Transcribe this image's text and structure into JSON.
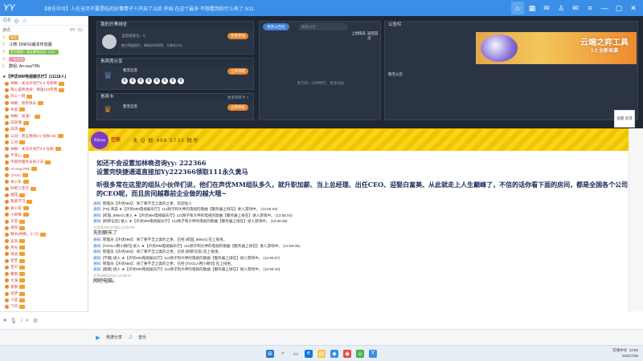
{
  "titlebar": {
    "logo": "YY",
    "title": "【收在中台】人在无尽不要是吃的好事情子人开启了以后 开始 在这个最多 不想看到的什么有了 0/11",
    "icons": [
      "home-icon",
      "grid-icon",
      "chat-icon",
      "shirt-icon",
      "mail-icon",
      "menu-icon",
      "minimize-icon",
      "maximize-icon",
      "close-icon"
    ]
  },
  "leftpanel": {
    "tools": [
      "G6",
      "◎",
      "☆"
    ],
    "header_left": "通讯",
    "header_right": "YY（1）",
    "ranks": [
      {
        "num": "1",
        "name": "老总",
        "extra": "精彩瞬间"
      },
      {
        "num": "2",
        "name": "斗琦: DNF60版本怀旧服",
        "extra": ""
      },
      {
        "num": "3",
        "name": "官方福利：周五晚场活动（6/8）",
        "extra": ""
      },
      {
        "num": "4",
        "name": "一起交流",
        "extra": ""
      },
      {
        "num": "5",
        "name": "群组: An-ssy/YRk",
        "extra": ""
      }
    ],
    "channel": "★【声优MM电视娱乐厅】(11118人)",
    "users": [
      "林枫：关注声优厅3 0 号频率",
      "现心提师连续：保送109年我",
      "开心一刻",
      "林枫：新年快乐",
      "木星",
      "林枫：加油！",
      "白玫瑰",
      "白鸽",
      "公司：周五晚场3 0 号频 6/8",
      "三月",
      "林枫：关注声优厅3 0 号频",
      "不开心",
      "不搞笑服务员的小天",
      "An-ssy/YRk",
      "小Ann",
      "张小乐",
      "好吧小宝贝",
      "烟花",
      "我爱学习",
      "翠小花",
      "小草莓",
      "天空",
      "清风",
      "静水(林枫，小小)",
      "追风",
      "月光",
      "海浪",
      "星空",
      "宝贝",
      "雾雨",
      "大海",
      "夜雨",
      "追梦",
      "小蓝",
      "飞鸟",
      "彩云",
      "风铃",
      "布丁",
      "林枫：关注声优厅3 0 号频",
      "心动",
      "Bo Bo Lo",
      "小明"
    ]
  },
  "main": {
    "card1": {
      "title": "我的开黑排坐",
      "status_label": "当前排坐位：0",
      "rule": "能力等级提升，每场实时获得，卡券总计分",
      "btn": "免费参加"
    },
    "card2": {
      "title": "贵宾席分享",
      "name": "暂无信息",
      "btn": "立即领取",
      "digits": [
        "0",
        "0",
        "0",
        "0",
        "0",
        "0",
        "0",
        "0"
      ]
    },
    "card3": {
      "title": "贵宾卡",
      "right": "更多贵宾卡 >",
      "name": "暂无信息",
      "btn": "立即领取"
    },
    "tabs": {
      "active": "贵宾公告栏",
      "search_placeholder": "搜索公告",
      "links": [
        "上周排名",
        "返回首页"
      ],
      "empty": "暂无每一分钟预告，更多动态"
    },
    "notice": {
      "title": "公告栏",
      "footer": "暂无公告"
    },
    "ad": {
      "line1": "云端之弈工具",
      "line2": "2.0 全新来袭"
    }
  },
  "announce": {
    "avatar_label": "声优MM",
    "name": "巴依",
    "qq": "永 Q 群 488 5733 群号"
  },
  "chat": {
    "big_lines": [
      "如还不会设置加林晚咨询yy: 222366",
      "设置完快捷通道直接加Yy222366领取111永久黄马",
      "",
      "听很多常在这里的组队小伙伴们说，他们在声优MM组队多久，就升职加薪、当上总经理、出任CEO、迎娶白富美、从此就走上人生巅峰了，不信的话你看下面的房间，都是全国各个公司的CEO呢，而且房间越靠前企业做的越大哦~"
    ],
    "messages": [
      {
        "tag": "通知:",
        "text": "管理员【声优MM】：除了要不乏之类的之余，欢迎加入"
      },
      {
        "tag": "通知:",
        "text": "[TN] 来自 ★【声优MM电视娱乐厅】111频子和大神的电视的歌曲【服务器上排在】进入游戏中。  (12:55:04)"
      },
      {
        "tag": "通知:",
        "text": "[校园_885e2] 进入 ★【声优MM电视娱乐厅】111频子和大神的电视的歌曲【服务器上排在】进入游戏中。  (12:55:04)"
      },
      {
        "tag": "通知:",
        "text": "[刷新信息] 进入 ★【声优MM电视娱乐厅】111频子和大神的电视的歌曲【服务器上排在】进入游戏中。  (12:55:05)"
      },
      {
        "tag": "",
        "text": "小宜灵(76137000)  12:55:05",
        "user": true
      },
      {
        "tag": "",
        "text": "先别聊天了",
        "plain": true
      },
      {
        "tag": "通知:",
        "text": "管理员【声优MM】：除了要不乏之类的之余，已经 [校园_885e2] 在上排坐。"
      },
      {
        "tag": "通知:",
        "text": "[TOGLA用小顾问] 进入 ★【声优MM电视娱乐厅】111频子和大神的电视的歌曲【服务器上排在】进入游戏中。  (12:55:06)"
      },
      {
        "tag": "通知:",
        "text": "管理员【声优MM】：除了要不乏之类的之余，已经 [刷新信息] 在上排坐。"
      },
      {
        "tag": "通知:",
        "text": "[不期] 进入 ★【声优MM电视娱乐厅】111频子和大神的电视的歌曲【服务器上排在】进入游戏中。  (12:55:07)"
      },
      {
        "tag": "通知:",
        "text": "管理员【声优MM】：除了要不乏之类的之余，已经 [TOGLA用小顾问] 在上排坐。"
      },
      {
        "tag": "通知:",
        "text": "[跟歌] 进入 ★【声优MM电视娱乐厅】111频子和大神的电视的歌曲【服务器上排在】进入游戏中。  (12:55:10)"
      },
      {
        "tag": "",
        "text": "天色(96821011)  12:55:10",
        "user": true
      },
      {
        "tag": "",
        "text": "网吧电脑。",
        "plain": true
      }
    ]
  },
  "float_btn": "提醒 反馈",
  "inputbar": {
    "items": [
      "热搜分享",
      "音乐"
    ]
  },
  "taskbar": {
    "tray_line1": "12:55",
    "tray_line2": "2021/7/28",
    "tray_lang": "在线中文"
  }
}
